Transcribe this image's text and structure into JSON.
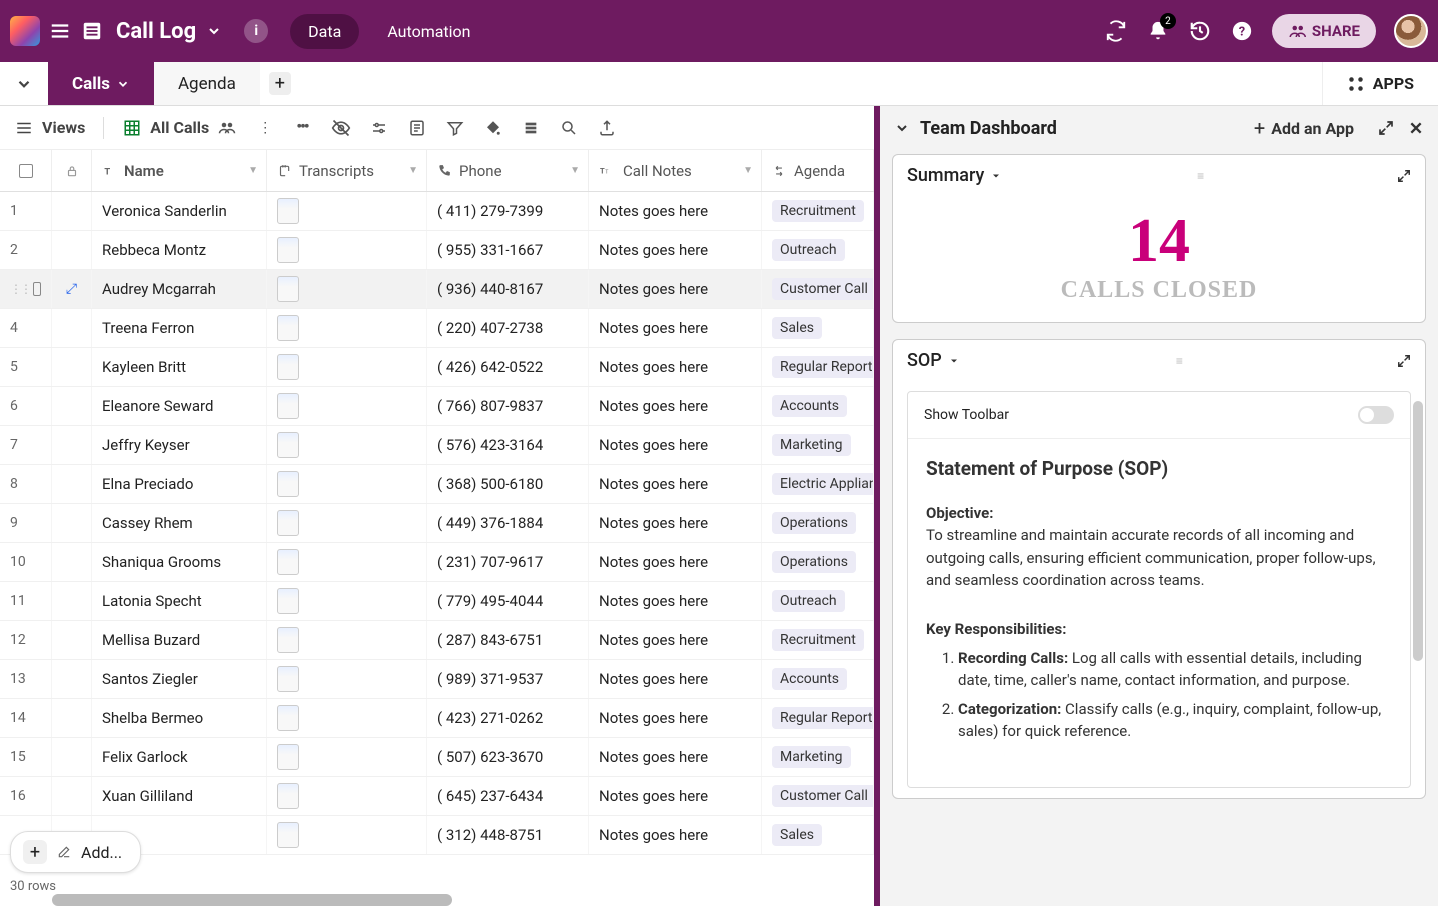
{
  "header": {
    "title": "Call Log",
    "data_label": "Data",
    "automation_label": "Automation",
    "share_label": "SHARE",
    "notif_count": "2"
  },
  "tabs": {
    "active": "Calls",
    "inactive": "Agenda",
    "apps_label": "APPS"
  },
  "toolbar": {
    "views_label": "Views",
    "allcalls_label": "All Calls"
  },
  "columns": {
    "name": "Name",
    "transcripts": "Transcripts",
    "phone": "Phone",
    "notes": "Call Notes",
    "agenda": "Agenda"
  },
  "rows": [
    {
      "n": "1",
      "name": "Veronica Sanderlin",
      "phone": "( 411) 279-7399",
      "notes": "Notes goes here",
      "agenda": "Recruitment"
    },
    {
      "n": "2",
      "name": "Rebbeca Montz",
      "phone": "( 955) 331-1667",
      "notes": "Notes goes here",
      "agenda": "Outreach"
    },
    {
      "n": "3",
      "name": "Audrey Mcgarrah",
      "phone": "( 936) 440-8167",
      "notes": "Notes goes here",
      "agenda": "Customer Call",
      "sel": true
    },
    {
      "n": "4",
      "name": "Treena Ferron",
      "phone": "( 220) 407-2738",
      "notes": "Notes goes here",
      "agenda": "Sales"
    },
    {
      "n": "5",
      "name": "Kayleen Britt",
      "phone": "( 426) 642-0522",
      "notes": "Notes goes here",
      "agenda": "Regular Report"
    },
    {
      "n": "6",
      "name": "Eleanore Seward",
      "phone": "( 766) 807-9837",
      "notes": "Notes goes here",
      "agenda": "Accounts"
    },
    {
      "n": "7",
      "name": "Jeffry Keyser",
      "phone": "( 576) 423-3164",
      "notes": "Notes goes here",
      "agenda": "Marketing"
    },
    {
      "n": "8",
      "name": "Elna Preciado",
      "phone": "( 368) 500-6180",
      "notes": "Notes goes here",
      "agenda": "Electric Appliance"
    },
    {
      "n": "9",
      "name": "Cassey Rhem",
      "phone": "( 449) 376-1884",
      "notes": "Notes goes here",
      "agenda": "Operations"
    },
    {
      "n": "10",
      "name": "Shaniqua Grooms",
      "phone": "( 231) 707-9617",
      "notes": "Notes goes here",
      "agenda": "Operations"
    },
    {
      "n": "11",
      "name": "Latonia Specht",
      "phone": "( 779) 495-4044",
      "notes": "Notes goes here",
      "agenda": "Outreach"
    },
    {
      "n": "12",
      "name": "Mellisa Buzard",
      "phone": "( 287) 843-6751",
      "notes": "Notes goes here",
      "agenda": "Recruitment"
    },
    {
      "n": "13",
      "name": "Santos Ziegler",
      "phone": "( 989) 371-9537",
      "notes": "Notes goes here",
      "agenda": "Accounts"
    },
    {
      "n": "14",
      "name": "Shelba Bermeo",
      "phone": "( 423) 271-0262",
      "notes": "Notes goes here",
      "agenda": "Regular Report"
    },
    {
      "n": "15",
      "name": "Felix Garlock",
      "phone": "( 507) 623-3670",
      "notes": "Notes goes here",
      "agenda": "Marketing"
    },
    {
      "n": "16",
      "name": "Xuan Gilliland",
      "phone": "( 645) 237-6434",
      "notes": "Notes goes here",
      "agenda": "Customer Call"
    },
    {
      "n": "",
      "name": "",
      "phone": "( 312) 448-8751",
      "notes": "Notes goes here",
      "agenda": "Sales"
    }
  ],
  "footer": {
    "add_label": "Add...",
    "row_count": "30 rows"
  },
  "side": {
    "title": "Team Dashboard",
    "add_app_label": "Add an App"
  },
  "summary_card": {
    "title": "Summary",
    "value": "14",
    "label": "CALLS CLOSED"
  },
  "sop_card": {
    "title": "SOP",
    "toolbar_label": "Show Toolbar",
    "heading": "Statement of Purpose (SOP)",
    "objective_h": "Objective:",
    "objective_body": "To streamline and maintain accurate records of all incoming and outgoing calls, ensuring efficient communication, proper follow-ups, and seamless coordination across teams.",
    "key_h": "Key Responsibilities:",
    "items": [
      {
        "b": "Recording Calls:",
        "t": " Log all calls with essential details, including date, time, caller's name, contact information, and purpose."
      },
      {
        "b": "Categorization:",
        "t": " Classify calls (e.g., inquiry, complaint, follow-up, sales) for quick reference."
      }
    ]
  }
}
